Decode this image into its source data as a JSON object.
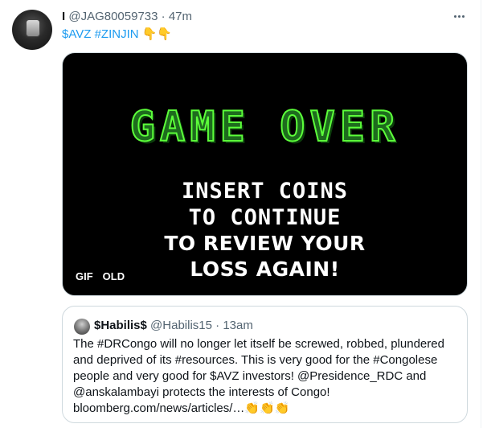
{
  "tweet": {
    "display_name": "I",
    "handle": "@JAG80059733",
    "separator": "·",
    "time": "47m",
    "text_tags": "$AVZ #ZINJIN",
    "text_emoji": "👇👇",
    "more_icon": "more-horizontal-icon"
  },
  "media": {
    "title": "GAME OVER",
    "line1": "INSERT COINS",
    "line2": "TO CONTINUE",
    "line3": "TO REVIEW YOUR",
    "line4": "LOSS AGAIN!",
    "badge_gif": "GIF",
    "badge_alt": "OLD",
    "colors": {
      "title_fill": "#1e6b1e",
      "title_outline": "#5cff3a"
    }
  },
  "quote": {
    "display_name": "$Habilis$",
    "handle": "@Habilis15",
    "separator": "·",
    "time": "13am",
    "body": "The #DRCongo will no longer let itself be screwed, robbed, plundered and deprived of its #resources. This is very good for the #Congolese people and very good for $AVZ investors!  @Presidence_RDC and @anskalambayi protects the interests of Congo! bloomberg.com/news/articles/…👏👏👏"
  },
  "colors": {
    "link": "#1d9bf0",
    "secondary_text": "#536471",
    "border": "#cfd9de"
  }
}
